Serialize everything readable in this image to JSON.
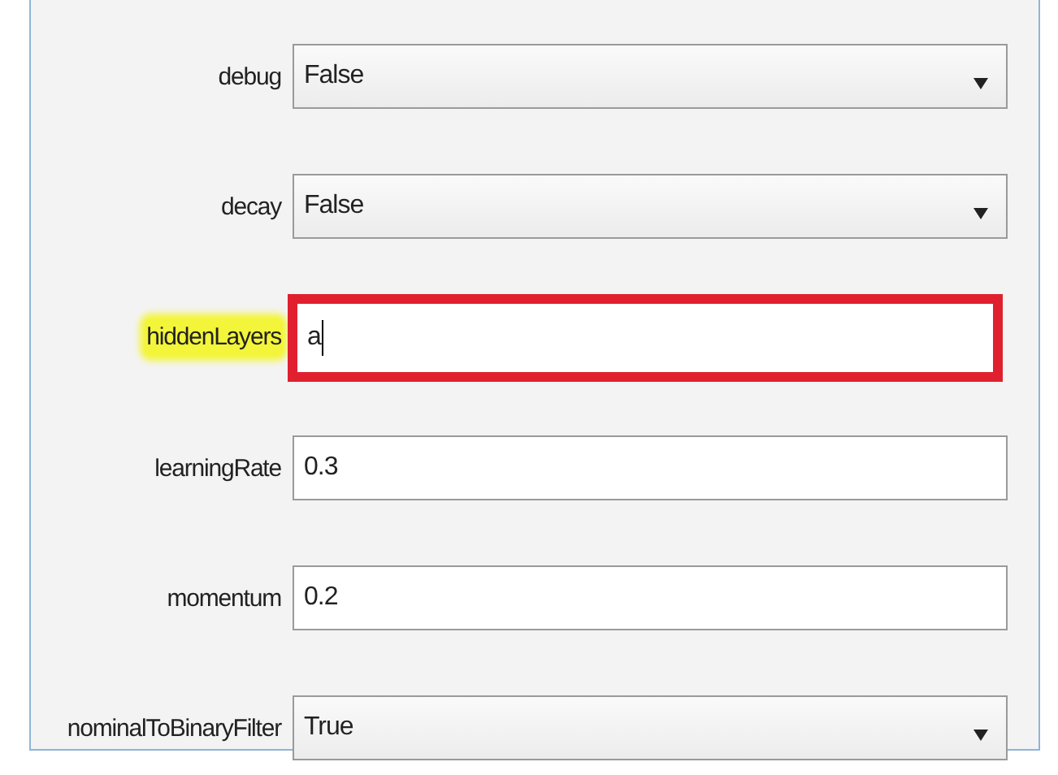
{
  "properties": [
    {
      "label": "debug",
      "kind": "select",
      "value": "False",
      "highlighted": false
    },
    {
      "label": "decay",
      "kind": "select",
      "value": "False",
      "highlighted": false
    },
    {
      "label": "hiddenLayers",
      "kind": "text",
      "value": "a",
      "highlighted": true
    },
    {
      "label": "learningRate",
      "kind": "text",
      "value": "0.3",
      "highlighted": false
    },
    {
      "label": "momentum",
      "kind": "text",
      "value": "0.2",
      "highlighted": false
    },
    {
      "label": "nominalToBinaryFilter",
      "kind": "select",
      "value": "True",
      "highlighted": false
    }
  ]
}
